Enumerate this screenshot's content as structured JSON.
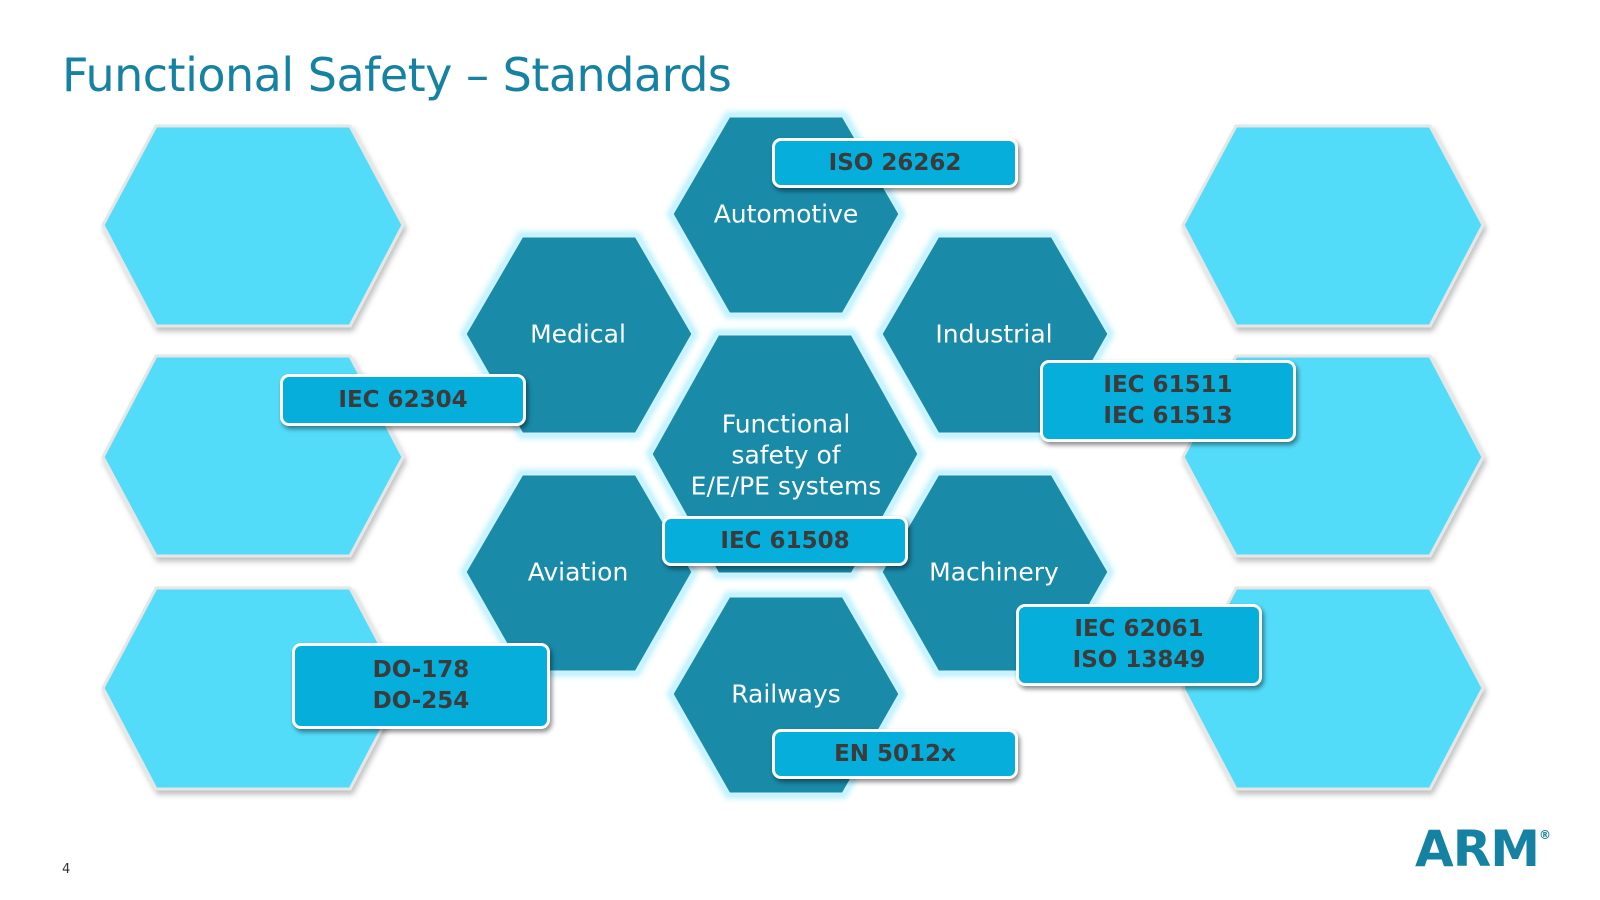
{
  "slide": {
    "title": "Functional Safety – Standards",
    "page_number": "4",
    "logo_text": "ARM",
    "logo_mark": "®"
  },
  "colors": {
    "title": "#1582a3",
    "dark_hex": "#1a8aa9",
    "light_hex": "#52dcfa",
    "glow": "#b8f0ff",
    "standard_box": "#05aedb",
    "standard_text": "#3b3b3b"
  },
  "domains": {
    "center": "Functional\nsafety of\nE/E/PE systems",
    "automotive": "Automotive",
    "medical": "Medical",
    "industrial": "Industrial",
    "aviation": "Aviation",
    "machinery": "Machinery",
    "railways": "Railways"
  },
  "standards": {
    "automotive": [
      "ISO 26262"
    ],
    "medical": [
      "IEC 62304"
    ],
    "industrial": [
      "IEC 61511",
      "IEC 61513"
    ],
    "center": [
      "IEC 61508"
    ],
    "aviation": [
      "DO-178",
      "DO-254"
    ],
    "machinery": [
      "IEC 62061",
      "ISO 13849"
    ],
    "railways": [
      "EN 5012x"
    ]
  }
}
